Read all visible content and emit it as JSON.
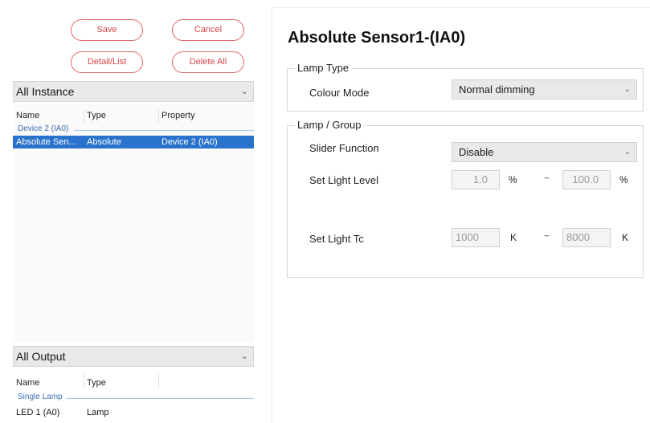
{
  "toolbar": {
    "save_label": "Save",
    "cancel_label": "Cancel",
    "detail_list_label": "Detail/List",
    "delete_all_label": "Delete All"
  },
  "instance_panel": {
    "selector_value": "All Instance",
    "columns": [
      "Name",
      "Type",
      "Property"
    ],
    "group_label": "Device 2 (IA0)",
    "rows": [
      {
        "name": "Absolute Sen...",
        "type": "Absolute",
        "property": "Device 2 (IA0)",
        "selected": true
      }
    ]
  },
  "output_panel": {
    "selector_value": "All Output",
    "columns": [
      "Name",
      "Type"
    ],
    "group_label": "Single Lamp",
    "rows": [
      {
        "name": "LED 1 (A0)",
        "type": "Lamp"
      }
    ]
  },
  "detail": {
    "title": "Absolute Sensor1-(IA0)",
    "lamp_type": {
      "legend": "Lamp Type",
      "colour_mode_label": "Colour Mode",
      "colour_mode_value": "Normal dimming"
    },
    "lamp_group": {
      "legend": "Lamp / Group",
      "slider_function_label": "Slider Function",
      "slider_function_value": "Disable",
      "set_light_level_label": "Set Light Level",
      "light_level_min": "1.0",
      "light_level_max": "100.0",
      "light_level_unit": "%",
      "set_light_tc_label": "Set Light Tc",
      "light_tc_min": "1000",
      "light_tc_max": "8000",
      "light_tc_unit": "K",
      "range_separator": "~"
    }
  },
  "icons": {
    "dropdown": "chevron-down-icon"
  },
  "colors": {
    "accent_red": "#d64545",
    "selection_blue": "#2a73cc",
    "group_blue": "#3b6db6"
  }
}
